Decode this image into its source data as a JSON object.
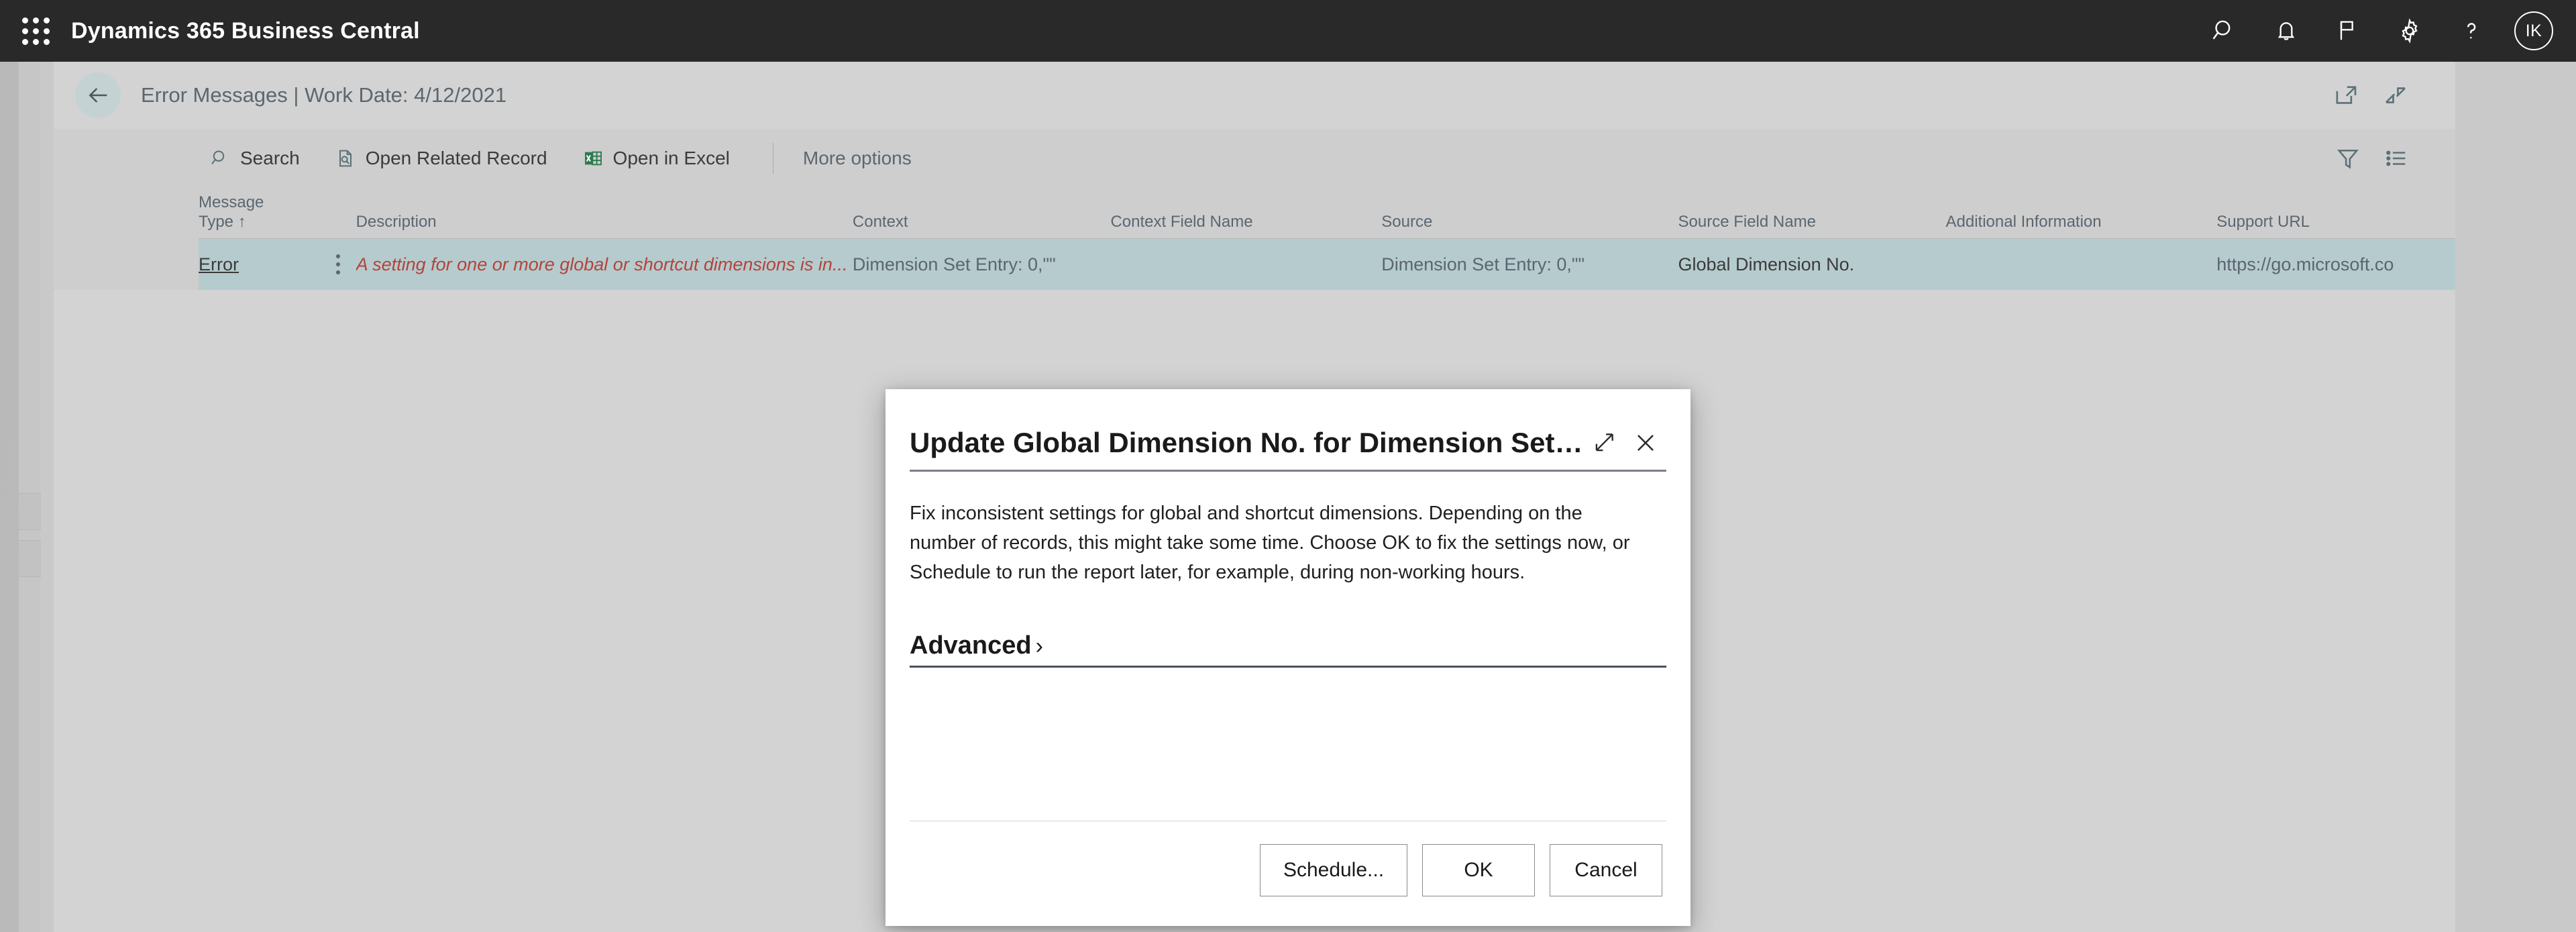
{
  "appbar": {
    "brand": "Dynamics 365 Business Central",
    "waffle_icon": "app-launcher-icon",
    "icons": [
      {
        "name": "search-icon",
        "label": "Search"
      },
      {
        "name": "bell-icon",
        "label": "Notifications"
      },
      {
        "name": "flag-icon",
        "label": "Feedback"
      },
      {
        "name": "gear-icon",
        "label": "Settings"
      },
      {
        "name": "help-icon",
        "label": "Help"
      }
    ],
    "avatar_initials": "IK",
    "background": "#292929"
  },
  "page": {
    "back_label": "Back",
    "title": "Error Messages | Work Date: 4/12/2021",
    "header_icons": [
      {
        "name": "open-in-new-window-icon"
      },
      {
        "name": "collapse-icon"
      }
    ]
  },
  "commandbar": {
    "items": [
      {
        "label": "Search",
        "icon": "search-icon"
      },
      {
        "label": "Open Related Record",
        "icon": "related-record-icon"
      },
      {
        "label": "Open in Excel",
        "icon": "excel-icon"
      }
    ],
    "more_options": "More options",
    "right_icons": [
      {
        "name": "filter-icon"
      },
      {
        "name": "list-view-icon"
      }
    ]
  },
  "table": {
    "columns": [
      {
        "header": "Message",
        "sub": "Type",
        "sort": "↑"
      },
      {
        "header": "Description"
      },
      {
        "header": "Context"
      },
      {
        "header": "Context Field Name"
      },
      {
        "header": "Source"
      },
      {
        "header": "Source Field Name"
      },
      {
        "header": "Additional Information"
      },
      {
        "header": "Support URL"
      }
    ],
    "rows": [
      {
        "message_type": "Error",
        "description": "A setting for one or more global or shortcut dimensions is in...",
        "context": "Dimension Set Entry: 0,\"\"",
        "context_field_name": "",
        "source": "Dimension Set Entry: 0,\"\"",
        "source_field_name": "Global Dimension No.",
        "additional_information": "",
        "support_url": "https://go.microsoft.co",
        "row_menu": "row-actions-icon",
        "selected": true
      }
    ],
    "selected_row_color": "#b6cbcd",
    "error_text_color": "#b2443c"
  },
  "dialog": {
    "title": "Update Global Dimension No. for Dimension Set E...",
    "expand_icon": "expand-icon",
    "close_icon": "close-icon",
    "body_text": "Fix inconsistent settings for global and shortcut dimensions. Depending on the number of records, this might take some time. Choose OK to fix the settings now, or Schedule to run the report later, for example, during non-working hours.",
    "advanced_label": "Advanced",
    "advanced_chevron": "›",
    "buttons": {
      "schedule": "Schedule...",
      "ok": "OK",
      "cancel": "Cancel"
    }
  }
}
